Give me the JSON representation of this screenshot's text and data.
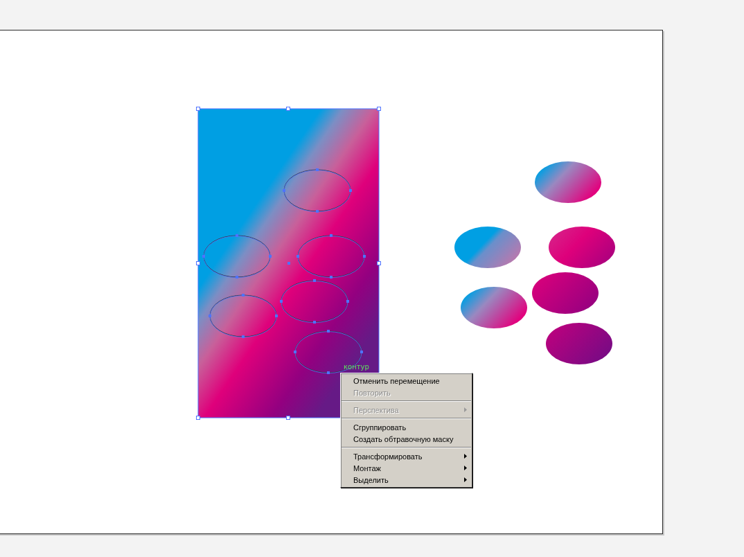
{
  "canvas": {
    "hint_label": "контур"
  },
  "context_menu": {
    "groups": [
      [
        {
          "label": "Отменить перемещение",
          "disabled": false,
          "submenu": false
        },
        {
          "label": "Повторить",
          "disabled": true,
          "submenu": false
        }
      ],
      [
        {
          "label": "Перспектива",
          "disabled": true,
          "submenu": true
        }
      ],
      [
        {
          "label": "Сгруппировать",
          "disabled": false,
          "submenu": false
        },
        {
          "label": "Создать обтравочную маску",
          "disabled": false,
          "submenu": false
        }
      ],
      [
        {
          "label": "Трансформировать",
          "disabled": false,
          "submenu": true
        },
        {
          "label": "Монтаж",
          "disabled": false,
          "submenu": true
        },
        {
          "label": "Выделить",
          "disabled": false,
          "submenu": true
        }
      ]
    ]
  }
}
